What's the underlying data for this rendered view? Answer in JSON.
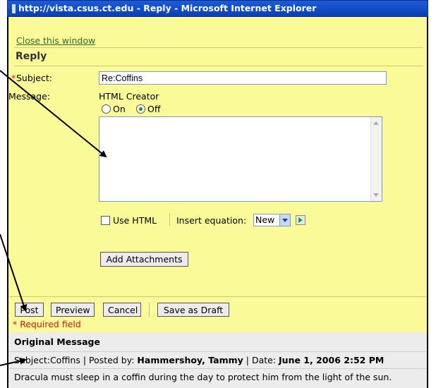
{
  "window": {
    "title": "http://vista.csus.ct.edu - Reply - Microsoft Internet Explorer"
  },
  "top": {
    "close_link": "Close this window",
    "heading": "Reply"
  },
  "form": {
    "subject_required_mark": "*",
    "subject_label": "Subject:",
    "subject_value": "Re:Coffins",
    "message_label": "Message:",
    "html_creator_label": "HTML Creator",
    "radio_on_label": "On",
    "radio_off_label": "Off",
    "radio_selected": "Off",
    "message_value": "",
    "use_html_label": "Use HTML",
    "insert_equation_label": "Insert equation:",
    "equation_select_value": "New",
    "add_attachments_label": "Add Attachments"
  },
  "actions": {
    "post": "Post",
    "preview": "Preview",
    "cancel": "Cancel",
    "save_draft": "Save as Draft",
    "required_note": "* Required field"
  },
  "original": {
    "heading": "Original Message",
    "subject_label": "Subject:",
    "subject_value": "Coffins",
    "sep1": "|",
    "posted_by_label": "Posted by:",
    "posted_by_value": "Hammershoy, Tammy",
    "sep2": "|",
    "date_label": "Date:",
    "date_value": "June 1, 2006 2:52 PM",
    "body": "Dracula must sleep in a coffin during the day to protect him from the light of the sun."
  },
  "colors": {
    "titlebar": "#0a3fb3",
    "page_background": "#fafa99",
    "required": "#d11111",
    "link": "#2f6b2f",
    "annotation_arrows": "#000000"
  }
}
